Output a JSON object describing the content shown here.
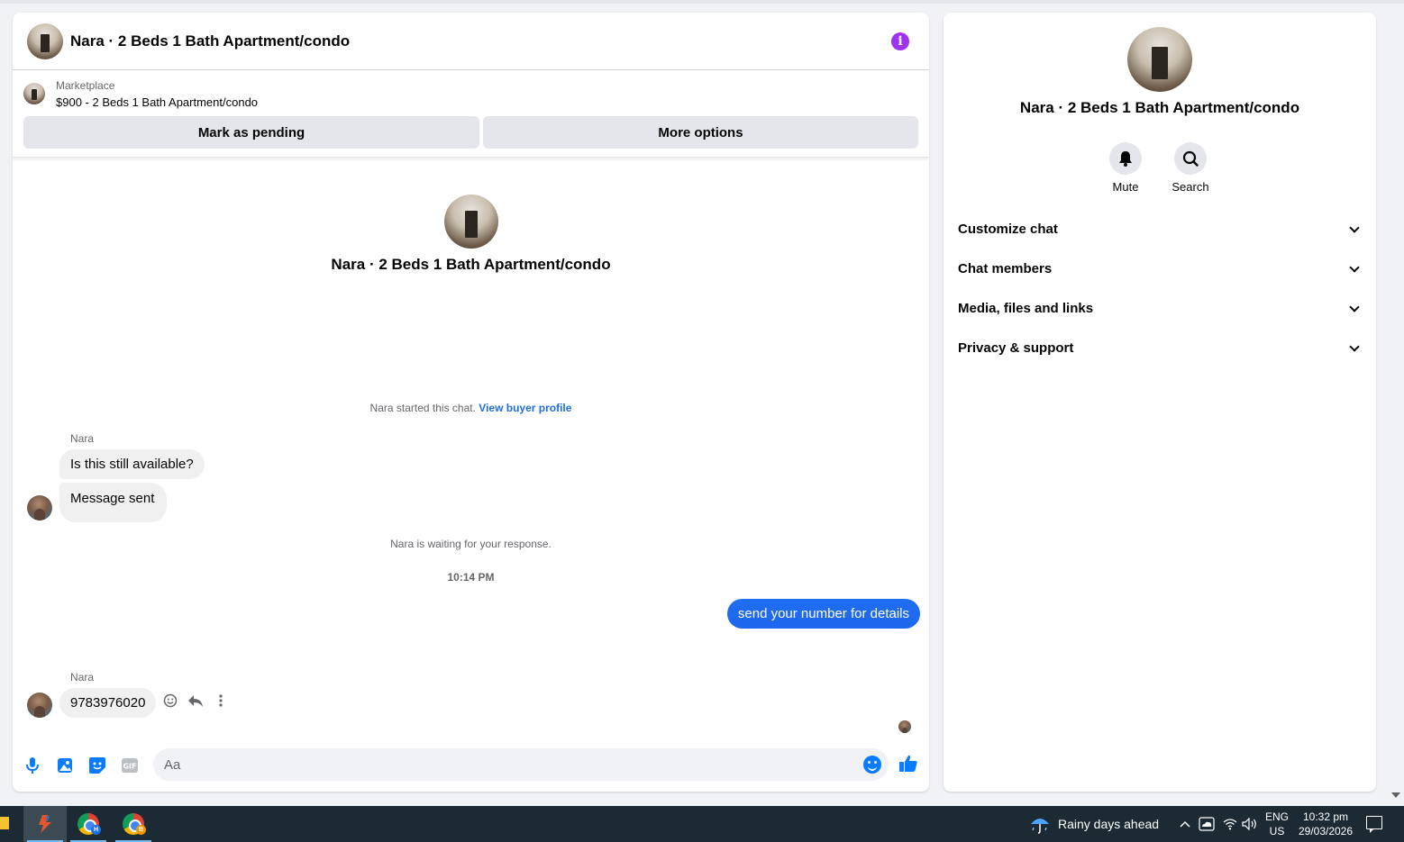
{
  "chat": {
    "title": "Nara · 2 Beds 1 Bath Apartment/condo",
    "marketplace_label": "Marketplace",
    "listing": "$900 - 2 Beds 1 Bath Apartment/condo",
    "mark_pending_label": "Mark as pending",
    "more_options_label": "More options",
    "intro_title": "Nara · 2 Beds 1 Bath Apartment/condo",
    "started_text": "Nara started this chat.",
    "view_buyer_profile": "View buyer profile",
    "waiting_text": "Nara is waiting for your response.",
    "timestamp": "10:14 PM",
    "messages": [
      {
        "sender": "Nara",
        "text": "Is this still available?"
      },
      {
        "sender": "Nara",
        "text": "Message sent"
      },
      {
        "sender": "me",
        "text": "send your number for details"
      },
      {
        "sender": "Nara",
        "text": "9783976020"
      }
    ],
    "composer_placeholder": "Aa",
    "accent_color": "#0a7cff",
    "info_color": "#a033f0"
  },
  "side": {
    "title": "Nara · 2 Beds 1 Bath Apartment/condo",
    "mute_label": "Mute",
    "search_label": "Search",
    "sections": [
      "Customize chat",
      "Chat members",
      "Media, files and links",
      "Privacy & support"
    ]
  },
  "taskbar": {
    "weather": "Rainy days ahead",
    "lang_line1": "ENG",
    "lang_line2": "US",
    "time": "10:32 pm",
    "date": "29/03/2026"
  }
}
